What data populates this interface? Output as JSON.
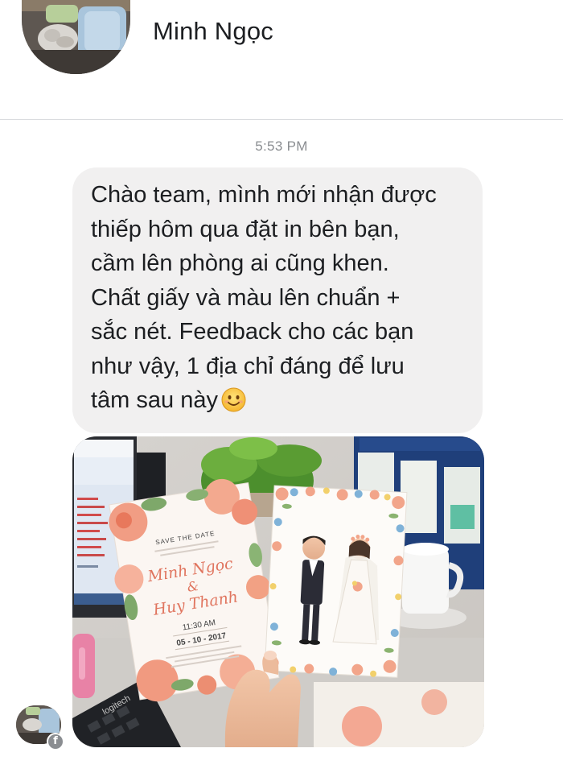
{
  "header": {
    "contact_name": "Minh Ngọc",
    "avatar_icon": "profile-photo-avatar"
  },
  "conversation": {
    "timestamp": "5:53 PM",
    "message": {
      "text": "Chào team, mình mới nhận được\nthiếp hôm qua đặt in bên bạn,\ncầm lên phòng ai cũng khen.\nChất giấy và màu lên chuẩn +\nsắc nét. Feedback cho các bạn\nnhư vậy, 1 địa chỉ đáng để lưu\ntâm sau này",
      "emoji_icon": "smiling-face-emoji"
    },
    "photo": {
      "description_icon": "photo-attachment",
      "invite_card": {
        "save_the_date": "SAVE THE DATE",
        "groom_script": "Minh Ngọc",
        "ampersand": "&",
        "bride_script": "Huy Thanh",
        "time": "11:30 AM",
        "date": "05 - 10 - 2017"
      },
      "keyboard_brand": "logitech"
    }
  },
  "sender": {
    "avatar_icon": "sender-avatar",
    "badge_icon": "facebook-icon",
    "badge_glyph": "f"
  },
  "colors": {
    "bubble_bg": "#f1f0f0",
    "timestamp": "#8a8d91",
    "text": "#1c1e21",
    "divider": "#d9dbde"
  }
}
